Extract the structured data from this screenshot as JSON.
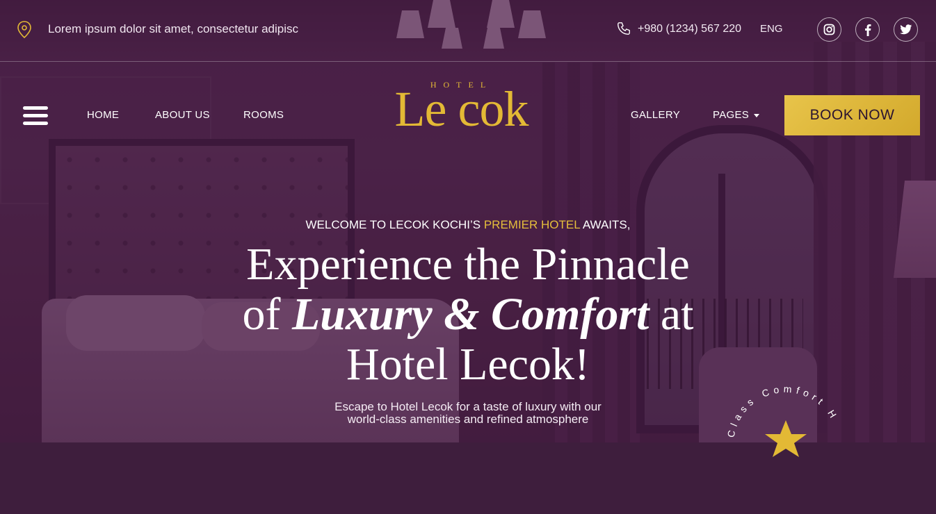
{
  "topbar": {
    "address": "Lorem ipsum dolor sit amet, consectetur adipisc",
    "phone": "+980 (1234) 567 220",
    "language": "ENG",
    "social": [
      "instagram-icon",
      "facebook-icon",
      "twitter-icon"
    ]
  },
  "nav": {
    "left": [
      "HOME",
      "ABOUT US",
      "ROOMS"
    ],
    "right": [
      "GALLERY",
      "PAGES"
    ],
    "book_label": "BOOK NOW"
  },
  "logo": {
    "small": "HOTEL",
    "name": "Le cok"
  },
  "hero": {
    "tagline_pre": "WELCOME TO LECOK KOCHI’S ",
    "tagline_highlight": "PREMIER HOTEL",
    "tagline_post": " AWAITS,",
    "headline_line1": "Experience the Pinnacle",
    "headline_pre": "of ",
    "headline_em": "Luxury & Comfort",
    "headline_post": " at",
    "headline_line3": "Hotel Lecok!",
    "sub_line1": "Escape to Hotel Lecok for a taste of luxury with our",
    "sub_line2": "world-class amenities and refined atmosphere",
    "badge_text": "Class Comfort H"
  },
  "colors": {
    "accent_gold": "#e3b935",
    "overlay_purple": "#481c46"
  }
}
